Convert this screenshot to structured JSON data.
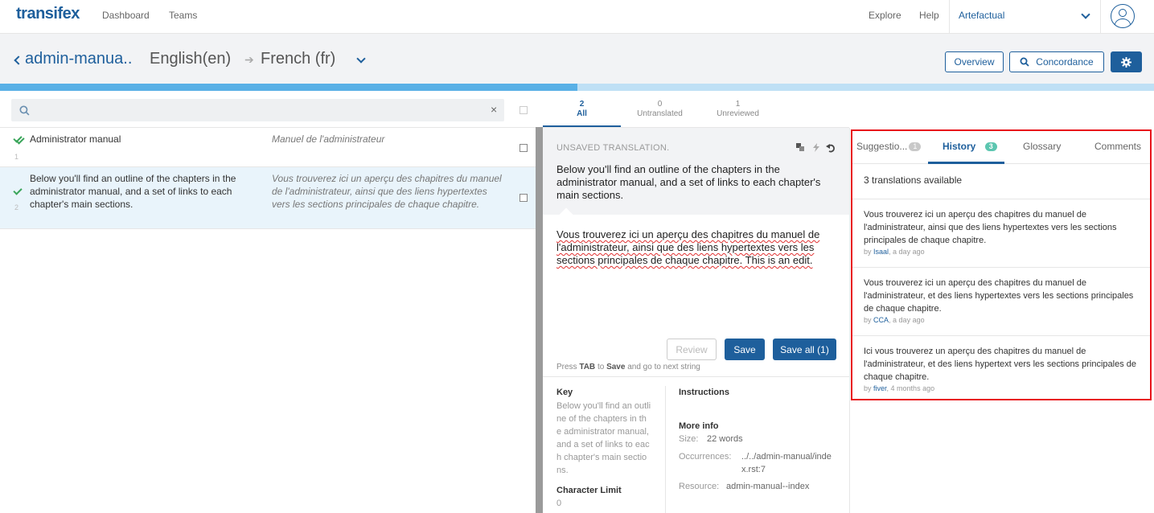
{
  "topbar": {
    "logo": "transifex",
    "nav": [
      "Dashboard",
      "Teams"
    ],
    "right_nav": [
      "Explore",
      "Help"
    ],
    "organization": "Artefactual"
  },
  "header": {
    "project": "admin-manua..",
    "source_language": "English(en)",
    "arrow": "➔",
    "target_language": "French (fr)",
    "overview_button": "Overview",
    "concordance_button": "Concordance",
    "progress_fraction": 0.5
  },
  "search": {
    "placeholder": "",
    "clear": "×"
  },
  "strings": [
    {
      "number": "1",
      "source": "Administrator manual",
      "target": "Manuel de l'administrateur"
    },
    {
      "number": "2",
      "source": "Below you'll find an outline of the chapters in the administrator manual, and a set of links to each chapter's main sections.",
      "target": "Vous trouverez ici un aperçu des chapitres du manuel de l'administrateur, ainsi que des liens hypertextes vers les sections principales de chaque chapitre."
    }
  ],
  "filters": [
    {
      "count": "2",
      "label": "All"
    },
    {
      "count": "0",
      "label": "Untranslated"
    },
    {
      "count": "1",
      "label": "Unreviewed"
    }
  ],
  "editor": {
    "status": "UNSAVED TRANSLATION.",
    "source": "Below you'll find an outline of the chapters in the administrator manual, and a set of links to each chapter's main sections.",
    "target": "Vous trouverez ici un aperçu des chapitres du manuel de l'administrateur, ainsi que des liens hypertextes vers les sections principales de chaque chapitre. This is an edit.",
    "review_button": "Review",
    "save_button": "Save",
    "save_all_button": "Save all (1)",
    "hint_prefix": "Press",
    "hint_key": "TAB",
    "hint_mid": "to",
    "hint_action": "Save",
    "hint_suffix": "and go to next string"
  },
  "meta": {
    "key_label": "Key",
    "key_value": "Below you'll find an outline of the chapters in the administrator manual, and a set of links to each chapter's main sections.",
    "char_limit_label": "Character Limit",
    "char_limit_value": "0",
    "instructions_label": "Instructions",
    "more_info_label": "More info",
    "size_label": "Size:",
    "size_value": "22 words",
    "occurrences_label": "Occurrences:",
    "occurrences_value": "../../admin-manual/index.rst:7",
    "resource_label": "Resource:",
    "resource_value": "admin-manual--index"
  },
  "side_panel": {
    "tabs": [
      {
        "label": "Suggestio...",
        "badge": "1"
      },
      {
        "label": "History",
        "badge": "3"
      },
      {
        "label": "Glossary"
      },
      {
        "label": "Comments"
      }
    ],
    "available": "3 translations available",
    "history": [
      {
        "text": "Vous trouverez ici un aperçu des chapitres du manuel de l'administrateur, ainsi que des liens hypertextes vers les sections principales de chaque chapitre.",
        "by": "by",
        "user": "Isaal",
        "when": ", a day ago"
      },
      {
        "text": "Vous trouverez ici un aperçu des chapitres du manuel de l'administrateur, et des liens hypertextes vers les sections principales de chaque chapitre.",
        "by": "by",
        "user": "CCA",
        "when": ", a day ago"
      },
      {
        "text": "Ici vous trouverez un aperçu des chapitres du manuel de l'administrateur, et des liens hypertext vers les sections principales de chaque chapitre.",
        "by": "by",
        "user": "fiver",
        "when": ", 4 months ago"
      }
    ]
  },
  "colors": {
    "brand": "#1e5f9c",
    "highlight": "#e8131a",
    "progress": "#59b0e6"
  }
}
